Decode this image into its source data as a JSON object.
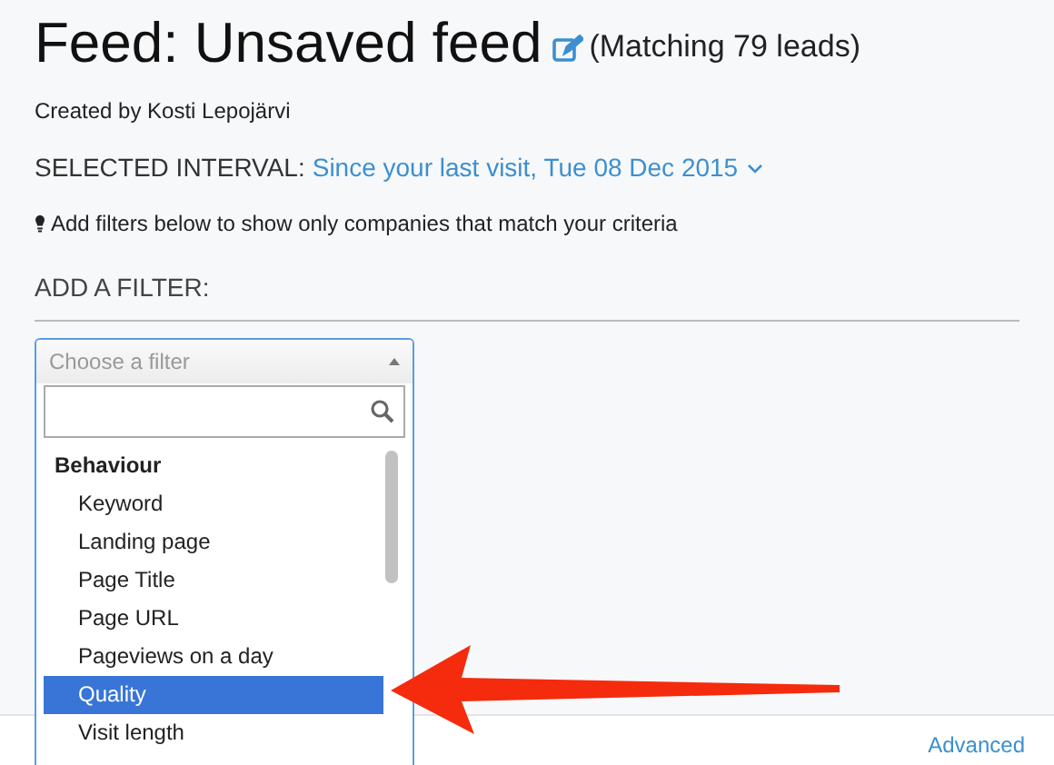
{
  "title": "Feed: Unsaved feed",
  "match_count": "(Matching 79 leads)",
  "created_by": "Created by Kosti Lepojärvi",
  "interval": {
    "label": "SELECTED INTERVAL:",
    "value": "Since your last visit, Tue 08 Dec 2015"
  },
  "hint": "Add filters below to show only companies that match your criteria",
  "add_filter": "ADD A FILTER:",
  "filter_select": {
    "placeholder": "Choose a filter",
    "expanded": true,
    "groups": [
      {
        "label": "Behaviour",
        "items": [
          {
            "label": "Keyword",
            "selected": false
          },
          {
            "label": "Landing page",
            "selected": false
          },
          {
            "label": "Page Title",
            "selected": false
          },
          {
            "label": "Page URL",
            "selected": false
          },
          {
            "label": "Pageviews on a day",
            "selected": false
          },
          {
            "label": "Quality",
            "selected": true
          },
          {
            "label": "Visit length",
            "selected": false
          }
        ]
      }
    ]
  },
  "footer_link": "Advanced"
}
